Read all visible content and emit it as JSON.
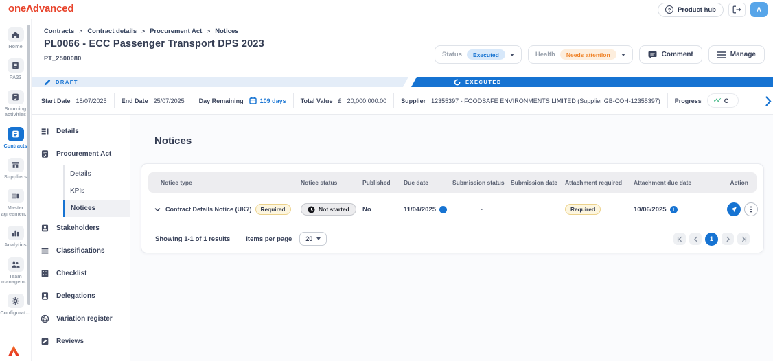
{
  "header": {
    "logo": "oneΛdvanced",
    "product_hub_label": "Product hub",
    "avatar_initial": "A"
  },
  "breadcrumb": {
    "links": [
      "Contracts",
      "Contract details",
      "Procurement Act"
    ],
    "current": "Notices"
  },
  "page": {
    "title": "PL0066 - ECC Passenger Transport DPS 2023",
    "reference": "PT_2500080"
  },
  "controls": {
    "status_label": "Status",
    "status_value": "Executed",
    "health_label": "Health",
    "health_value": "Needs attention",
    "comment_label": "Comment",
    "manage_label": "Manage"
  },
  "stages": {
    "draft": "DRAFT",
    "executed": "EXECUTED"
  },
  "info_bar": {
    "start_date_label": "Start Date",
    "start_date": "18/07/2025",
    "end_date_label": "End Date",
    "end_date": "25/07/2025",
    "day_remaining_label": "Day Remaining",
    "day_remaining": "109 days",
    "total_value_label": "Total Value",
    "currency": "£",
    "total_value": "20,000,000.00",
    "supplier_label": "Supplier",
    "supplier": "12355397 - FOODSAFE ENVIRONMENTS LIMITED (Supplier GB-COH-12355397)",
    "progress_label": "Progress",
    "progress_value": "C"
  },
  "nav_rail": {
    "items": [
      {
        "label": "Home"
      },
      {
        "label": "PA23"
      },
      {
        "label": "Sourcing activities"
      },
      {
        "label": "Contracts"
      },
      {
        "label": "Suppliers"
      },
      {
        "label": "Master agreemen…"
      },
      {
        "label": "Analytics"
      },
      {
        "label": "Team managem…"
      },
      {
        "label": "Configurat…"
      }
    ]
  },
  "sidebar": {
    "items": [
      {
        "label": "Details"
      },
      {
        "label": "Procurement Act"
      },
      {
        "label": "Details"
      },
      {
        "label": "KPIs"
      },
      {
        "label": "Notices"
      },
      {
        "label": "Stakeholders"
      },
      {
        "label": "Classifications"
      },
      {
        "label": "Checklist"
      },
      {
        "label": "Delegations"
      },
      {
        "label": "Variation register"
      },
      {
        "label": "Reviews"
      }
    ]
  },
  "notices": {
    "heading": "Notices",
    "columns": [
      "Notice type",
      "Notice status",
      "Published",
      "Due date",
      "Submission status",
      "Submission date",
      "Attachment required",
      "Attachment due date",
      "Action"
    ],
    "row": {
      "notice_type": "Contract Details Notice (UK7)",
      "notice_type_badge": "Required",
      "notice_status": "Not started",
      "published": "No",
      "due_date": "11/04/2025",
      "submission_status": "-",
      "submission_date": "",
      "attachment_required": "Required",
      "attachment_due_date": "10/06/2025"
    },
    "footer": {
      "showing": "Showing 1-1 of 1 results",
      "items_per_page_label": "Items per page",
      "items_per_page": "20",
      "page": "1"
    }
  },
  "colors": {
    "primary_blue": "#1673d2",
    "brand_orange": "#e8432b",
    "executed_pill_bg": "#d7e8fa",
    "executed_pill_text": "#1270d0",
    "attention_pill_bg": "#fdeedd",
    "attention_pill_text": "#ef8125",
    "required_pill_bg": "#fdf6df",
    "required_pill_border": "#ecd28c",
    "success_green": "#2fb079"
  }
}
